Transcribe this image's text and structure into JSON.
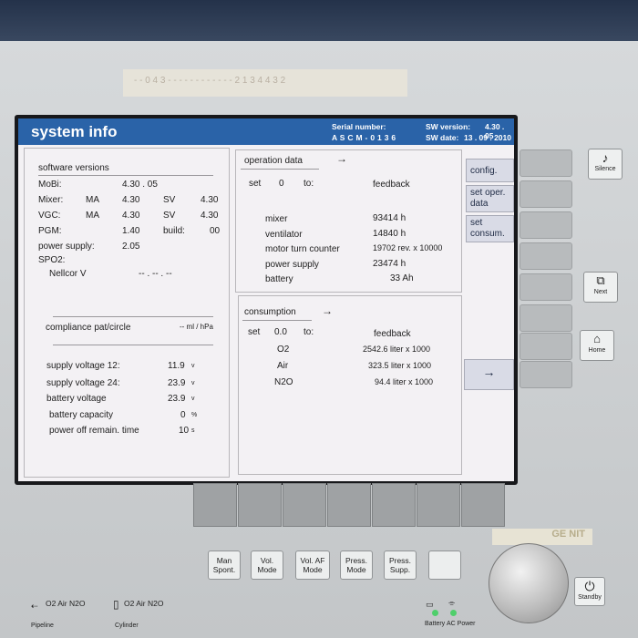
{
  "screen": {
    "title": "system info",
    "header": {
      "serial_label": "Serial number:",
      "serial_value": "A S C M - 0 1 3 6",
      "sw_version_label": "SW version:",
      "sw_version_value": "4.30 . 05",
      "sw_date_label": "SW date:",
      "sw_date_value": "13 . 09 . 2010"
    },
    "software": {
      "heading": "software versions",
      "mobi_label": "MoBi:",
      "mobi_value": "4.30 . 05",
      "mixer_label": "Mixer:",
      "mixer_ma": "MA",
      "mixer_ma_value": "4.30",
      "mixer_sv": "SV",
      "mixer_sv_value": "4.30",
      "vgc_label": "VGC:",
      "vgc_ma": "MA",
      "vgc_ma_value": "4.30",
      "vgc_sv": "SV",
      "vgc_sv_value": "4.30",
      "pgm_label": "PGM:",
      "pgm_value": "1.40",
      "build_label": "build:",
      "build_value": "00",
      "power_supply_label": "power supply:",
      "power_supply_value": "2.05",
      "spo2_label": "SPO2:",
      "nellcor_label": "Nellcor V",
      "nellcor_value": "-- . -- . --"
    },
    "compliance": {
      "label": "compliance pat/circle",
      "value": "-- ml / hPa"
    },
    "status": [
      {
        "label": "supply voltage 12:",
        "value": "11.9",
        "unit": "v"
      },
      {
        "label": "supply voltage 24:",
        "value": "23.9",
        "unit": "v"
      },
      {
        "label": "battery voltage",
        "value": "23.9",
        "unit": "v"
      },
      {
        "label": "battery capacity",
        "value": "0",
        "unit": "%"
      },
      {
        "label": "power off remain. time",
        "value": "10",
        "unit": "s"
      }
    ],
    "operation": {
      "title": "operation data",
      "set_label": "set",
      "set_value": "0",
      "to_label": "to:",
      "feedback_label": "feedback",
      "rows": [
        {
          "label": "mixer",
          "value": "93414 h"
        },
        {
          "label": "ventilator",
          "value": "14840 h"
        },
        {
          "label": "motor turn counter",
          "value": "19702 rev. x 10000"
        },
        {
          "label": "power supply",
          "value": "23474 h"
        },
        {
          "label": "battery",
          "value": "33 Ah"
        }
      ]
    },
    "consumption": {
      "title": "consumption",
      "set_label": "set",
      "set_value": "0.0",
      "to_label": "to:",
      "feedback_label": "feedback",
      "rows": [
        {
          "label": "O2",
          "value": "2542.6 liter x 1000"
        },
        {
          "label": "Air",
          "value": "323.5 liter x 1000"
        },
        {
          "label": "N2O",
          "value": "94.4 liter x 1000"
        }
      ]
    },
    "side_buttons": {
      "config": "config.",
      "set_oper_1": "set oper.",
      "set_oper_2": "data",
      "set_consum_1": "set",
      "set_consum_2": "consum."
    },
    "arrow_glyph": "→"
  },
  "device": {
    "tape_text": "- - 0 4 3 - - - - - - - - - - - - 2 1 3 4 4 3 2",
    "silence_label": "Silence",
    "next_label": "Next",
    "home_label": "Home",
    "standby_label": "Standby",
    "mode_buttons": [
      {
        "line1": "Man",
        "line2": "Spont."
      },
      {
        "line1": "Vol.",
        "line2": "Mode"
      },
      {
        "line1": "Vol. AF",
        "line2": "Mode"
      },
      {
        "line1": "Press.",
        "line2": "Mode"
      },
      {
        "line1": "Press.",
        "line2": "Supp."
      }
    ],
    "pipeline_gases": "O2  Air  N2O",
    "pipeline_label": "Pipeline",
    "cylinder_gases": "O2  Air  N2O",
    "cylinder_label": "Cylinder",
    "battery_label": "Battery",
    "ac_power_label": "AC Power",
    "sticker_text": "GE NIT"
  },
  "colors": {
    "title_bar": "#2a63a8",
    "screen_bg": "#f3f1f4",
    "bezel": "#c9ccce"
  }
}
